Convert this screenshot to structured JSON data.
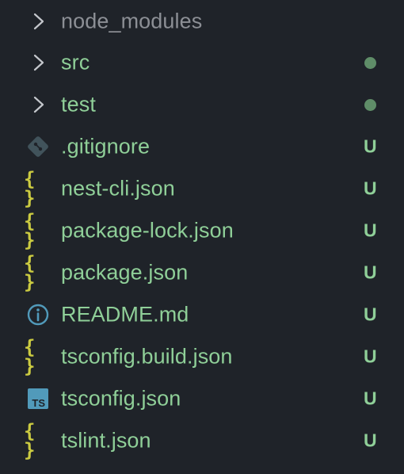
{
  "colors": {
    "background": "#1f2329",
    "untracked": "#8fcf98",
    "ignored": "#8c8f95",
    "chevron": "#c4c7cc",
    "json_icon": "#cbcb41",
    "git_icon": "#41535b",
    "info_icon": "#519aba",
    "ts_icon": "#519aba",
    "modified_dot": "#5f8d68"
  },
  "explorer": {
    "items": [
      {
        "icon": "chevron-right-icon",
        "label": "node_modules",
        "status": "",
        "decoration": "none",
        "kind": "folder"
      },
      {
        "icon": "chevron-right-icon",
        "label": "src",
        "status": "",
        "decoration": "dot",
        "kind": "folder"
      },
      {
        "icon": "chevron-right-icon",
        "label": "test",
        "status": "",
        "decoration": "dot",
        "kind": "folder"
      },
      {
        "icon": "git-icon",
        "label": ".gitignore",
        "status": "U",
        "decoration": "letter",
        "kind": "file"
      },
      {
        "icon": "json-braces-icon",
        "label": "nest-cli.json",
        "status": "U",
        "decoration": "letter",
        "kind": "file"
      },
      {
        "icon": "json-braces-icon",
        "label": "package-lock.json",
        "status": "U",
        "decoration": "letter",
        "kind": "file"
      },
      {
        "icon": "json-braces-icon",
        "label": "package.json",
        "status": "U",
        "decoration": "letter",
        "kind": "file"
      },
      {
        "icon": "info-icon",
        "label": "README.md",
        "status": "U",
        "decoration": "letter",
        "kind": "file"
      },
      {
        "icon": "json-braces-icon",
        "label": "tsconfig.build.json",
        "status": "U",
        "decoration": "letter",
        "kind": "file"
      },
      {
        "icon": "typescript-icon",
        "label": "tsconfig.json",
        "status": "U",
        "decoration": "letter",
        "kind": "file"
      },
      {
        "icon": "json-braces-icon",
        "label": "tslint.json",
        "status": "U",
        "decoration": "letter",
        "kind": "file"
      }
    ],
    "json_icon_glyph": "{ }",
    "ts_icon_text": "TS"
  }
}
